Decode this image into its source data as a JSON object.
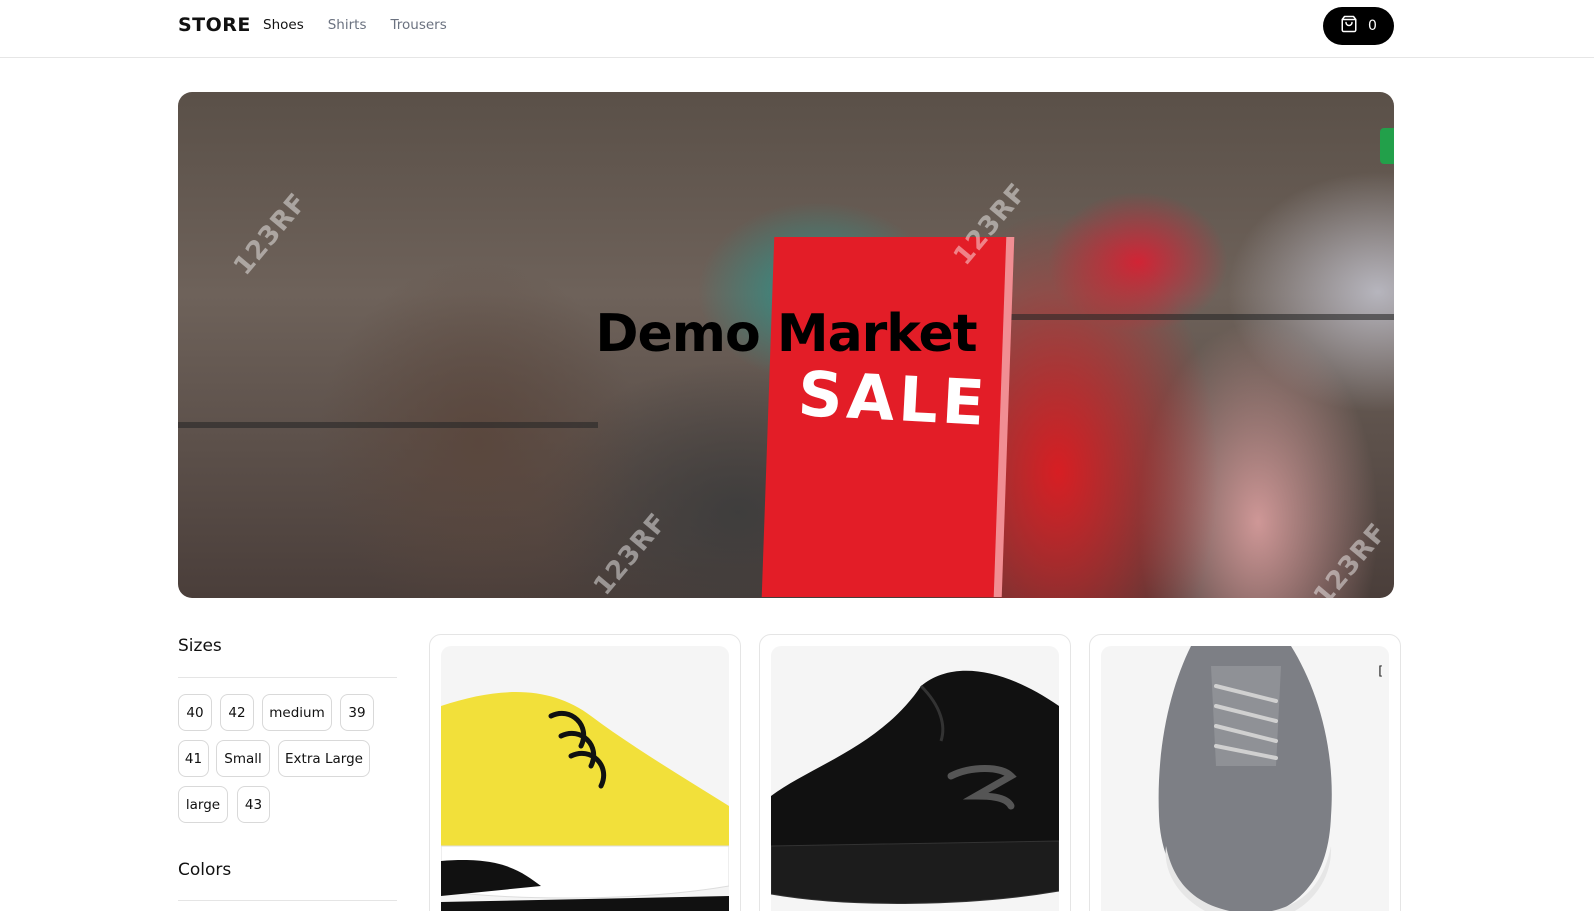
{
  "navbar": {
    "brand": "STORE",
    "links": [
      {
        "label": "Shoes",
        "active": true
      },
      {
        "label": "Shirts",
        "active": false
      },
      {
        "label": "Trousers",
        "active": false
      }
    ],
    "cart": {
      "icon": "shopping-bag-icon",
      "count": "0"
    }
  },
  "hero": {
    "title": "Demo Market",
    "sign_text": "SALE",
    "watermark_text": "123RF"
  },
  "filters": {
    "sizes_heading": "Sizes",
    "sizes": [
      "40",
      "42",
      "medium",
      "39",
      "41",
      "Small",
      "Extra Large",
      "large",
      "43"
    ],
    "colors_heading": "Colors"
  },
  "products": [
    {
      "image": "yellow-sneaker-image",
      "shoe_color": "#f2e03a"
    },
    {
      "image": "black-sneaker-image",
      "shoe_color": "#111111"
    },
    {
      "image": "grey-sneaker-image",
      "shoe_color": "#7d7f85",
      "corner_text": "["
    }
  ]
}
